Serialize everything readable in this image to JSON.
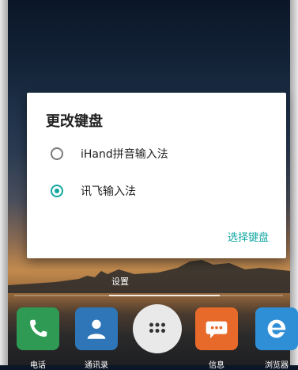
{
  "dialog": {
    "title": "更改键盘",
    "options": [
      {
        "label": "iHand拼音输入法",
        "selected": false
      },
      {
        "label": "讯飞输入法",
        "selected": true
      }
    ],
    "action_label": "选择键盘"
  },
  "home": {
    "settings_label": "设置"
  },
  "dock": {
    "apps": [
      {
        "label": "电话",
        "icon": "phone-icon"
      },
      {
        "label": "通讯录",
        "icon": "contacts-icon"
      },
      {
        "label": "",
        "icon": "app-drawer-icon"
      },
      {
        "label": "信息",
        "icon": "messages-icon"
      },
      {
        "label": "浏览器",
        "icon": "browser-icon"
      }
    ]
  },
  "colors": {
    "accent": "#12a6a1",
    "phone": "#2e9a53",
    "contacts": "#2e76b8",
    "messages": "#e86a2a",
    "browser": "#2f8fd6"
  }
}
